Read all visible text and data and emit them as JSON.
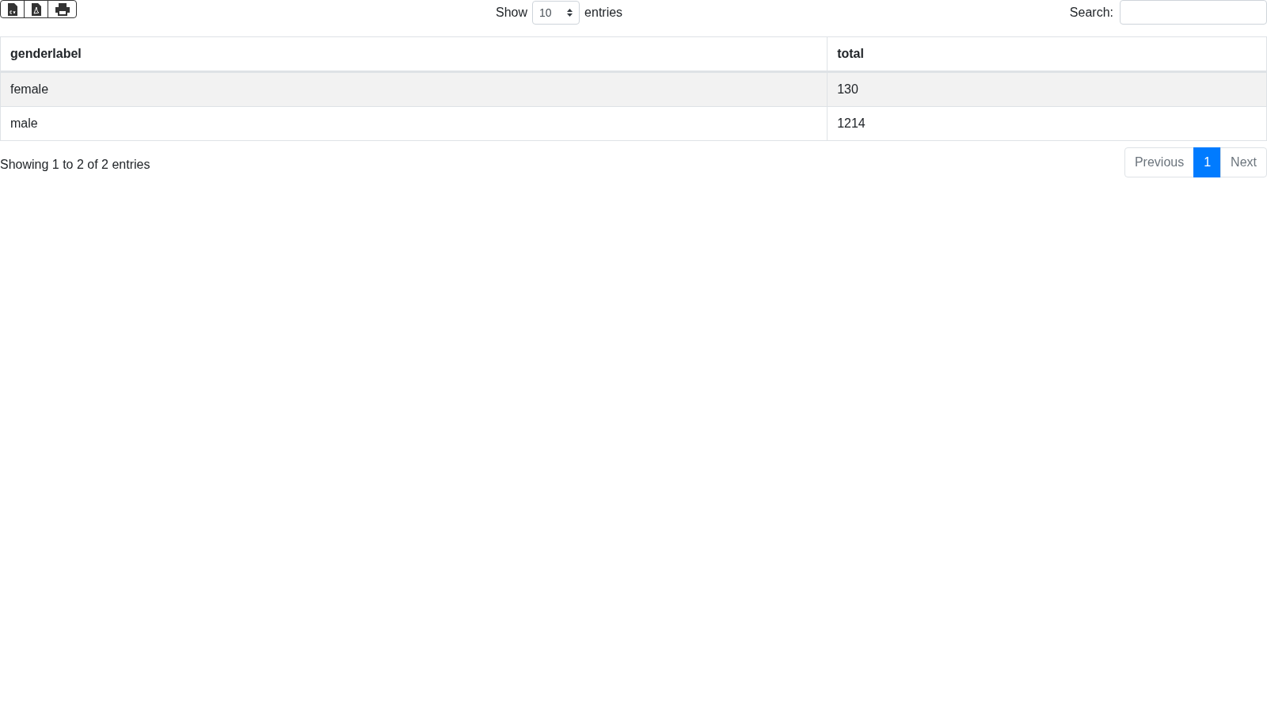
{
  "export_buttons": [
    {
      "kind": "csv"
    },
    {
      "kind": "pdf"
    },
    {
      "kind": "print"
    }
  ],
  "length": {
    "before": "Show",
    "value": "10",
    "after": "entries"
  },
  "search": {
    "label": "Search:"
  },
  "table": {
    "columns": [
      "genderlabel",
      "total"
    ],
    "rows": [
      {
        "cells": [
          "female",
          "130"
        ],
        "striped": true
      },
      {
        "cells": [
          "male",
          "1214"
        ],
        "striped": false
      }
    ]
  },
  "info": "Showing 1 to 2 of 2 entries",
  "pagination": [
    {
      "label": "Previous",
      "disabled": true,
      "selected": false
    },
    {
      "label": "1",
      "disabled": false,
      "selected": true
    },
    {
      "label": "Next",
      "disabled": true,
      "selected": false
    }
  ]
}
